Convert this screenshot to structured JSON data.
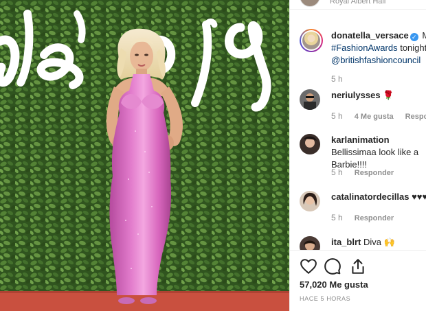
{
  "post": {
    "image_alt": "Woman in pink sequin gown on red carpet in front of green hedge wall with white script lettering",
    "backdrop_text_left": "ds",
    "backdrop_text_right": "019"
  },
  "header": {
    "location": "Royal Albert Hall"
  },
  "caption": {
    "username": "donatella_versace",
    "verified_glyph": "✓",
    "text_start": "My",
    "hashtag": "#FashionAwards",
    "text_mid": " tonight!",
    "mention": "@britishfashioncouncil",
    "time": "5 h"
  },
  "comments": [
    {
      "username": "neriulysses",
      "text": "🌹",
      "time": "5 h",
      "likes": "4 Me gusta",
      "reply": "Responder"
    },
    {
      "username": "karlanimation",
      "text": "Bellissimaa look like a Barbie!!!!",
      "time": "5 h",
      "reply": "Responder"
    },
    {
      "username": "catalinatordecillas",
      "text": "♥♥♥",
      "time": "5 h",
      "reply": "Responder"
    },
    {
      "username": "ita_blrt",
      "text": "Diva 🙌"
    }
  ],
  "actions": {
    "like_icon": "heart-icon",
    "comment_icon": "comment-icon",
    "share_icon": "share-icon",
    "likes_count": "57,020 Me gusta",
    "posted_time": "HACE 5 HORAS"
  },
  "colors": {
    "link": "#003569",
    "muted": "#8e8e8e",
    "text": "#262626",
    "verified": "#3897f0",
    "gown": "#d96ac0",
    "hedge": "#3f6b2a",
    "carpet": "#c9503f"
  }
}
